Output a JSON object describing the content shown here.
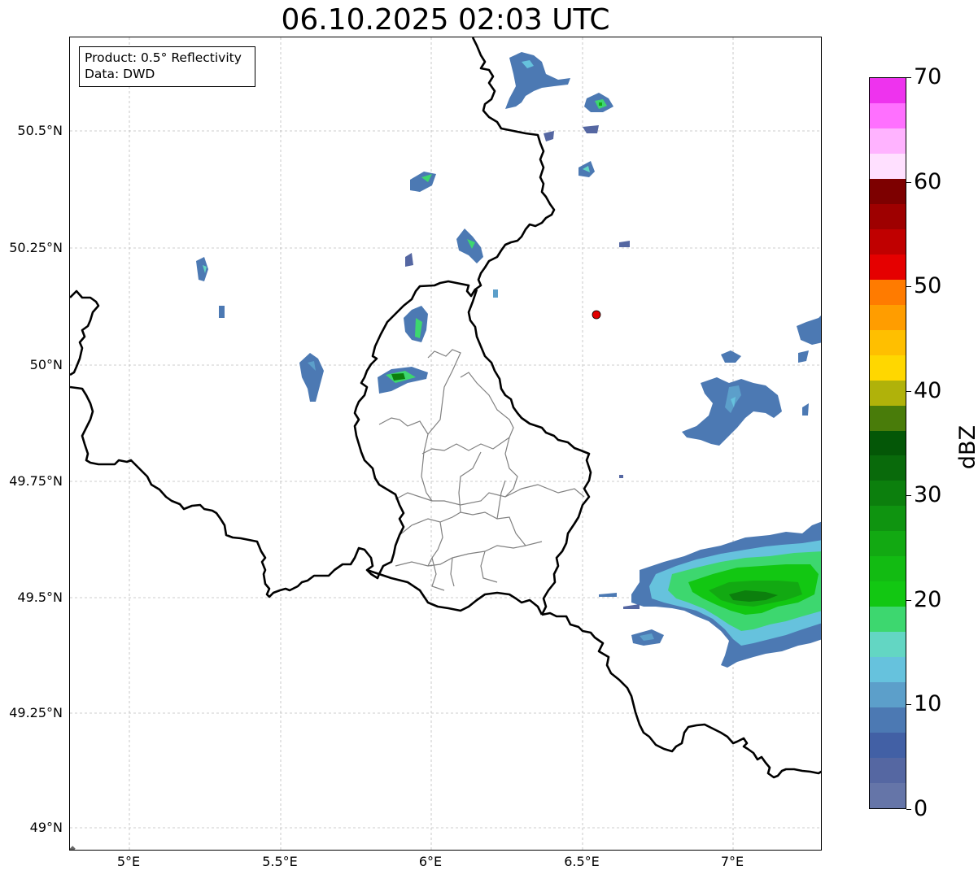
{
  "title": "06.10.2025 02:03 UTC",
  "info_box": {
    "product": "Product: 0.5° Reflectivity",
    "data": "Data: DWD"
  },
  "map": {
    "lat_labels": [
      "50.5°N",
      "50.25°N",
      "50°N",
      "49.75°N",
      "49.5°N",
      "49.25°N",
      "49°N"
    ],
    "lon_labels": [
      "5°E",
      "5.5°E",
      "6°E",
      "6.5°E",
      "7°E"
    ],
    "radar_site_marker_color": "#e00000",
    "gridlines": "dashed, gray"
  },
  "colorbar": {
    "label": "dBZ",
    "tick_labels": [
      "0",
      "10",
      "20",
      "30",
      "40",
      "50",
      "60",
      "70"
    ],
    "range": [
      0,
      70
    ],
    "step": 2.5,
    "colors": [
      "#6575a8",
      "#5567a2",
      "#4260a5",
      "#4c79b3",
      "#5c9fca",
      "#66c2dd",
      "#63d6c3",
      "#3dd76f",
      "#12c712",
      "#12bb12",
      "#12a912",
      "#0f9410",
      "#0c7f0d",
      "#096a0b",
      "#045707",
      "#497c0a",
      "#b0b20a",
      "#ffd700",
      "#ffbf00",
      "#ff9d00",
      "#ff7b00",
      "#e50000",
      "#c00000",
      "#9e0000",
      "#7d0000",
      "#ffe0ff",
      "#ffb3ff",
      "#ff70ff",
      "#ee33ee"
    ]
  }
}
